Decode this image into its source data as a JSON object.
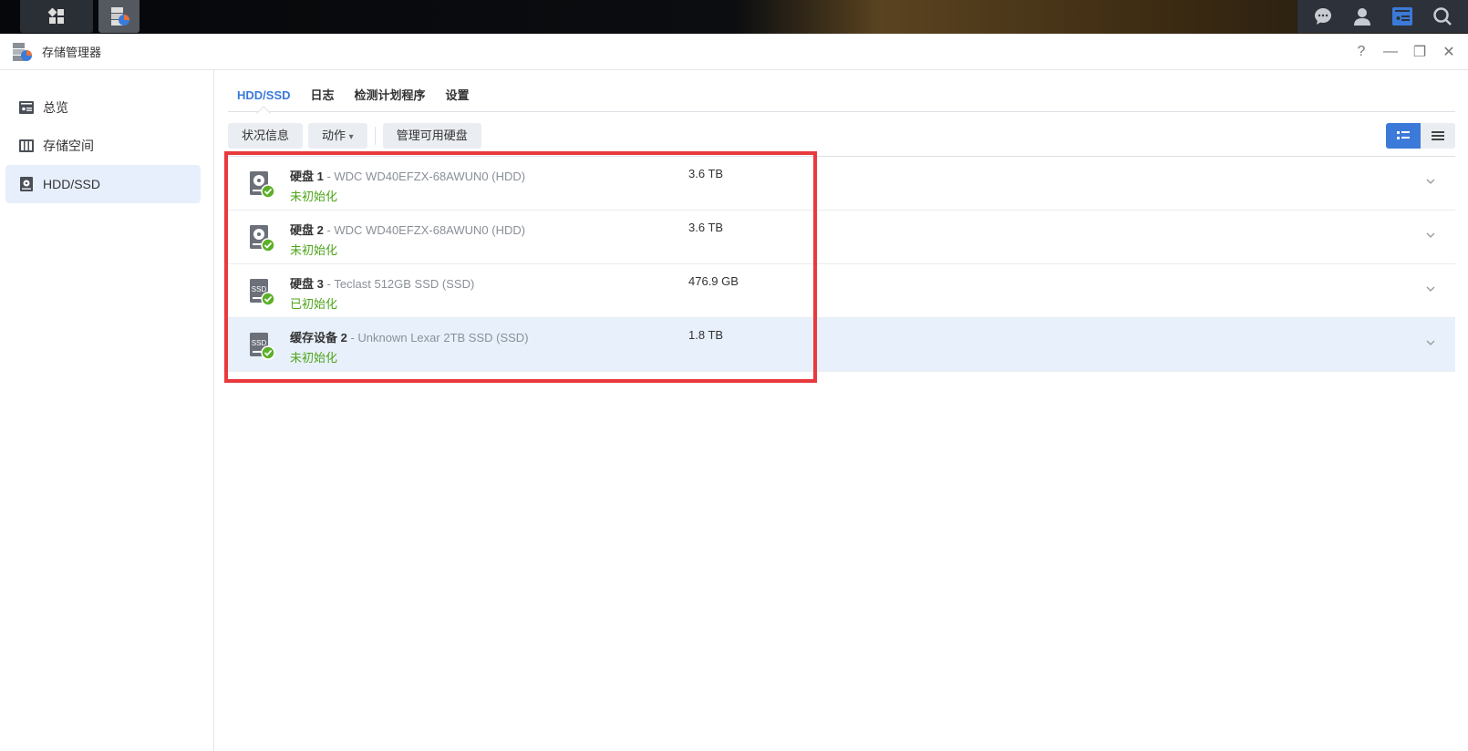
{
  "window": {
    "title": "存储管理器"
  },
  "window_controls": {
    "help": "?",
    "minimize": "—",
    "restore": "❐",
    "close": "✕"
  },
  "sidebar": {
    "items": [
      {
        "label": "总览",
        "icon": "overview-icon"
      },
      {
        "label": "存储空间",
        "icon": "storage-pool-icon"
      },
      {
        "label": "HDD/SSD",
        "icon": "hdd-icon",
        "active": true
      }
    ]
  },
  "tabs": [
    {
      "label": "HDD/SSD",
      "active": true
    },
    {
      "label": "日志"
    },
    {
      "label": "检测计划程序"
    },
    {
      "label": "设置"
    }
  ],
  "toolbar": {
    "info": "状况信息",
    "action": "动作",
    "action_caret": "▾",
    "manage": "管理可用硬盘"
  },
  "disks": [
    {
      "name": "硬盘 1",
      "model": " - WDC WD40EFZX-68AWUN0 (HDD)",
      "status": "未初始化",
      "size": "3.6 TB",
      "type": "HDD"
    },
    {
      "name": "硬盘 2",
      "model": " - WDC WD40EFZX-68AWUN0 (HDD)",
      "status": "未初始化",
      "size": "3.6 TB",
      "type": "HDD"
    },
    {
      "name": "硬盘 3",
      "model": " - Teclast 512GB SSD (SSD)",
      "status": "已初始化",
      "size": "476.9 GB",
      "type": "SSD"
    },
    {
      "name": "缓存设备 2",
      "model": " - Unknown Lexar 2TB SSD (SSD)",
      "status": "未初始化",
      "size": "1.8 TB",
      "type": "SSD",
      "selected": true
    }
  ],
  "colors": {
    "accent": "#3b7ad9",
    "status_ok": "#4ea51b",
    "highlight": "#e8393c"
  }
}
